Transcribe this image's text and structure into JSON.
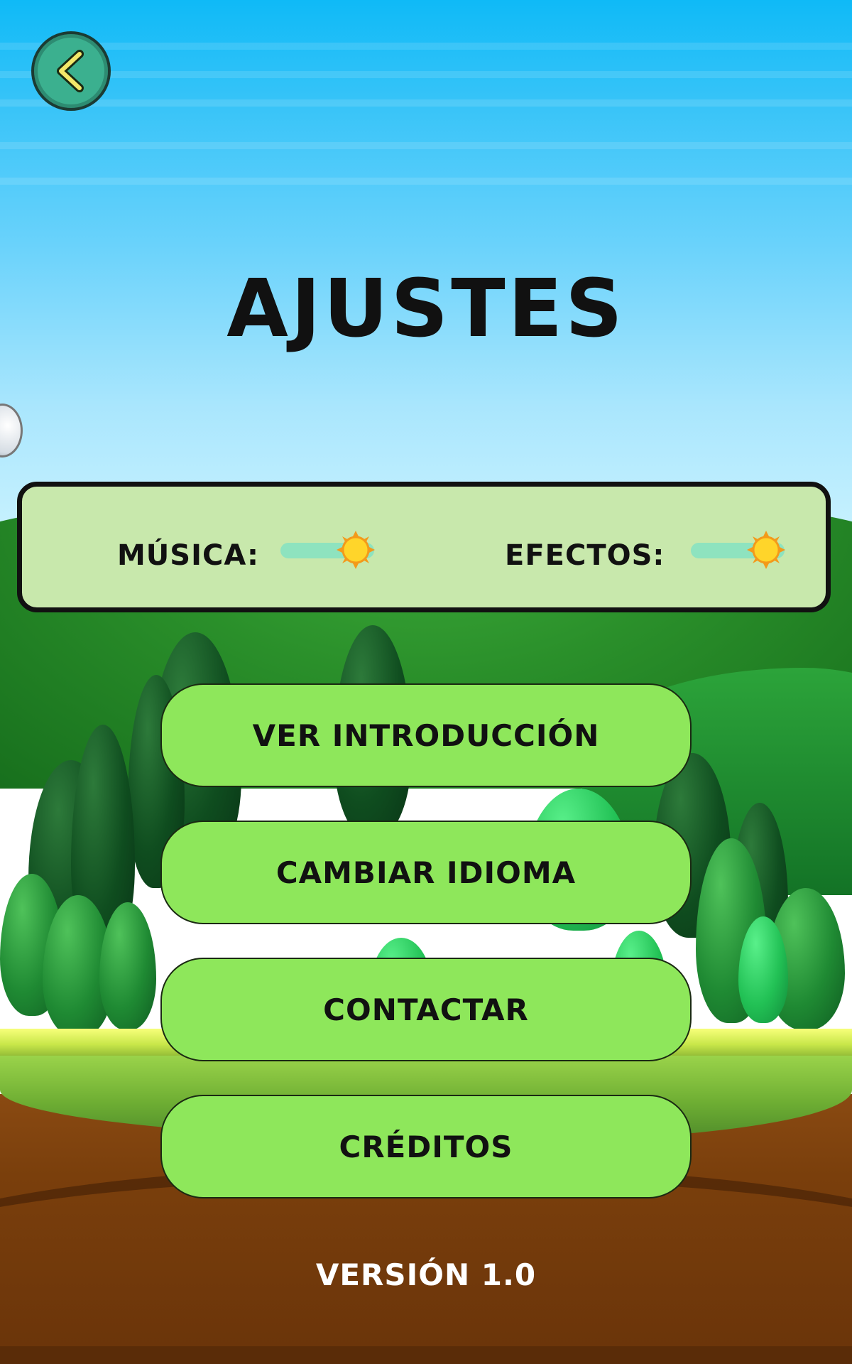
{
  "screen": {
    "title": "AJUSTES",
    "version_label": "VERSIÓN 1.0"
  },
  "header": {
    "back_icon": "chevron-left-icon"
  },
  "audio": {
    "music_label": "MÚSICA:",
    "music_level": 0.8,
    "effects_label": "EFECTOS:",
    "effects_level": 0.8,
    "slider_thumb_icon": "sun-icon"
  },
  "menu": {
    "items": [
      {
        "label": "VER INTRODUCCIÓN"
      },
      {
        "label": "CAMBIAR IDIOMA"
      },
      {
        "label": "CONTACTAR"
      },
      {
        "label": "CRÉDITOS"
      }
    ]
  },
  "colors": {
    "button_fill": "#8ee75b",
    "panel_fill": "#c8e8ac",
    "back_button_fill": "#3bb08f",
    "slider_track": "#8ee3bf",
    "sun_thumb": "#ffd52a"
  }
}
